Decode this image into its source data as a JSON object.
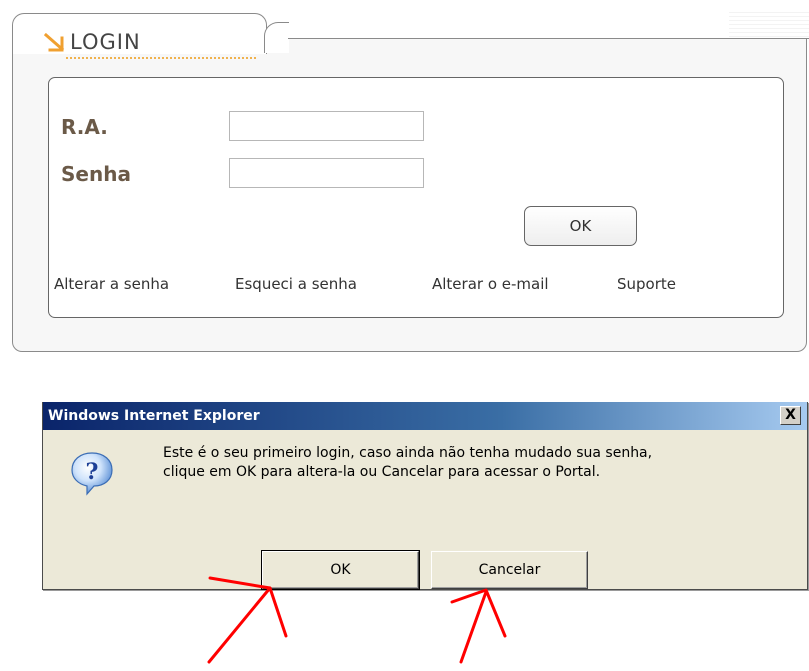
{
  "login": {
    "title": "LOGIN",
    "fields": {
      "ra_label": "R.A.",
      "ra_value": "",
      "senha_label": "Senha",
      "senha_value": ""
    },
    "ok_label": "OK",
    "links": {
      "change_password": "Alterar a senha",
      "forgot_password": "Esqueci a senha",
      "change_email": "Alterar o e-mail",
      "support": "Suporte"
    },
    "accent_color": "#f0a030"
  },
  "dialog": {
    "title": "Windows Internet Explorer",
    "close_label": "X",
    "icon": "question-icon",
    "message_line1": "Este é o seu primeiro login, caso ainda não tenha mudado sua senha,",
    "message_line2": "clique em OK para altera-la ou Cancelar para acessar o Portal.",
    "ok_label": "OK",
    "cancel_label": "Cancelar"
  },
  "annotations": {
    "arrow_color": "#ff0000"
  }
}
